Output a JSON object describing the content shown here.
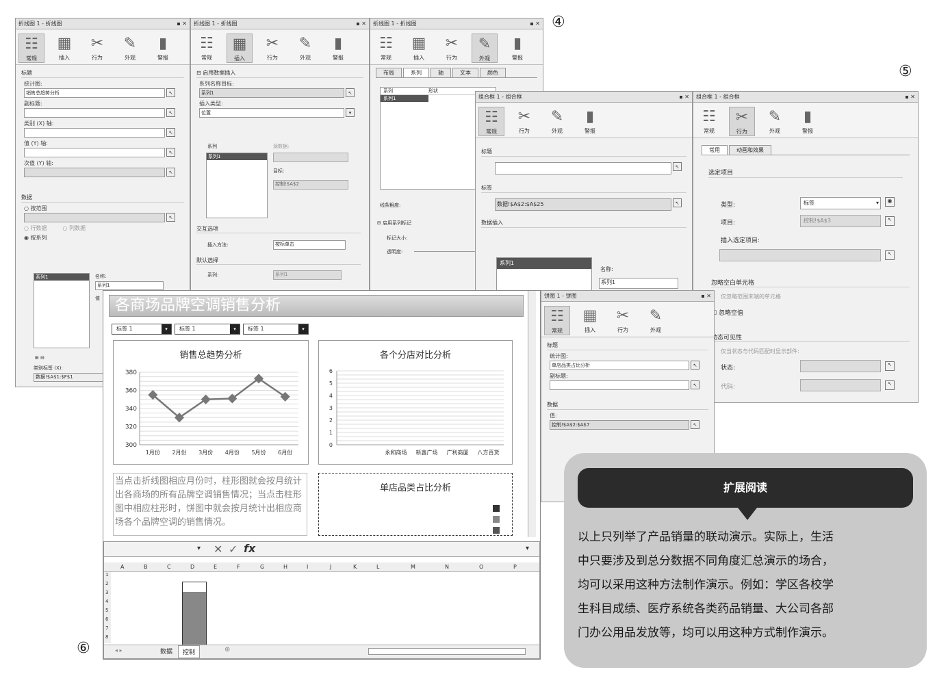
{
  "markers": {
    "four": "④",
    "five": "⑤",
    "six": "⑥"
  },
  "ribbon": {
    "general": "常规",
    "insert": "插入",
    "action": "行为",
    "appearance": "外观",
    "alert": "警报"
  },
  "panel1": {
    "title": "折线图 1 - 折线图",
    "section_title": "标题",
    "chart_label": "统计图:",
    "chart_value": "销售总趋势分析",
    "subtitle_label": "副标题:",
    "category_label": "类别 (X) 轴:",
    "value_label": "值 (Y) 轴:",
    "secondary_label": "次值 (Y) 轴:",
    "data_section": "数据",
    "by_range": "按范围",
    "row_label": "行数据",
    "col_label": "列数据",
    "by_series": "按系列",
    "series_item": "系列1",
    "name_label": "名称:",
    "name_value": "系列1",
    "value_short": "值",
    "category_axis_label": "类别标签 (X):",
    "category_axis_value": "数据!$A$1:$F$1"
  },
  "panel2": {
    "title": "折线图 1 - 折线图",
    "enable_insert": "启用数据插入",
    "series_target_label": "系列名称目标:",
    "series_target_value": "系列1",
    "insert_type_label": "插入类型:",
    "insert_type_value": "位置",
    "series_col": "系列",
    "source_col": "源数据:",
    "series_item": "系列1",
    "target_label": "目标:",
    "target_value": "控制!$A$2",
    "interaction_section": "交互选项",
    "insert_method_label": "插入方法:",
    "insert_method_value": "按标单击",
    "default_section": "默认选择",
    "series_label": "系列:",
    "series_default": "系列1"
  },
  "panel3": {
    "title": "折线图 1 - 折线图",
    "tabs": [
      "布局",
      "系列",
      "轴",
      "文本",
      "颜色"
    ],
    "col_series": "系列",
    "col_shape": "形状",
    "series_item": "系列1",
    "line_thickness": "线条粗度:",
    "enable_marker": "启用系列标记",
    "marker_size": "标记大小:",
    "transparency": "透明度:"
  },
  "panel4": {
    "title": "组合框 1 - 组合框",
    "section_title": "标题",
    "label_section": "标签",
    "label_value": "数据!$A$2:$A$25",
    "insert_section": "数据插入",
    "series_item": "系列1",
    "name_label": "名称:",
    "name_value": "系列1"
  },
  "panel5": {
    "title": "组合框 1 - 组合框",
    "tabs": [
      "常用",
      "动画和效果"
    ],
    "selected_item": "选定项目",
    "type_label": "类型:",
    "type_value": "标签",
    "item_label": "项目:",
    "item_value": "控制!$A$3",
    "insert_selected": "插入选定项目:",
    "ignore_blank_section": "忽略空白单元格",
    "ignore_blank_desc": "仅忽略范围末端的单元格",
    "ignore_blank_check": "忽略空值",
    "visibility_section": "动态可见性",
    "visibility_desc": "仅当状态与代码匹配时显示部件:",
    "status_label": "状态:",
    "code_label": "代码:"
  },
  "panel6": {
    "title": "饼图 1 - 饼图",
    "section_title": "标题",
    "chart_label": "统计图:",
    "chart_value": "单店品类占比分析",
    "subtitle_label": "副标题:",
    "data_section": "数据",
    "value_label": "值:",
    "value_value": "控制!$A$2:$A$7"
  },
  "dashboard": {
    "title": "各商场品牌空调销售分析",
    "dropdowns": [
      "标签 1",
      "标签 1",
      "标签 1"
    ],
    "description": "当点击折线图相应月份时，柱形图就会按月统计出各商场的所有品牌空调销售情况；当点击柱形图中相应柱形时，饼图中就会按月统计出相应商场各个品牌空调的销售情况。"
  },
  "line_chart": {
    "title": "销售总趋势分析",
    "categories": [
      "1月份",
      "2月份",
      "3月份",
      "4月份",
      "5月份",
      "6月份"
    ],
    "values": [
      355,
      330,
      350,
      351,
      373,
      353
    ],
    "yticks": [
      "380",
      "360",
      "340",
      "320",
      "300"
    ],
    "ylim": [
      300,
      380
    ],
    "color": "#777777"
  },
  "bar_chart": {
    "title": "各个分店对比分析",
    "categories": [
      "永和商场",
      "新鑫广场",
      "广利商厦",
      "八方百货"
    ],
    "yticks": [
      "6",
      "5",
      "4",
      "3",
      "2",
      "1",
      "0"
    ]
  },
  "pie_chart": {
    "title": "单店品类占比分析"
  },
  "chart_data": [
    {
      "type": "line",
      "title": "销售总趋势分析",
      "categories": [
        "1月份",
        "2月份",
        "3月份",
        "4月份",
        "5月份",
        "6月份"
      ],
      "series": [
        {
          "values": [
            355,
            330,
            350,
            351,
            373,
            353
          ]
        }
      ],
      "ylim": [
        300,
        380
      ],
      "grid": true
    },
    {
      "type": "bar",
      "title": "各个分店对比分析",
      "categories": [
        "永和商场",
        "新鑫广场",
        "广利商厦",
        "八方百货"
      ],
      "series": [
        {
          "values": [
            0,
            0,
            0,
            0
          ]
        }
      ],
      "ylim": [
        0,
        6
      ],
      "grid": true
    },
    {
      "type": "pie",
      "title": "单店品类占比分析",
      "values": []
    }
  ],
  "spreadsheet": {
    "fx": "fx",
    "columns": [
      "A",
      "B",
      "C",
      "D",
      "E",
      "F",
      "G",
      "H",
      "I",
      "J",
      "K",
      "L",
      "M",
      "N",
      "O",
      "P"
    ],
    "rows": [
      "1",
      "2",
      "3",
      "4",
      "5",
      "6",
      "7",
      "8"
    ],
    "sheet_tabs": [
      "数据",
      "控制"
    ]
  },
  "callout": {
    "heading": "扩展阅读",
    "lines": [
      "以上只列举了产品销量的联动演示。实际上，生活",
      "中只要涉及到总分数据不同角度汇总演示的场合，",
      "均可以采用这种方法制作演示。例如：学区各校学",
      "生科目成绩、医疗系统各类药品销量、大公司各部",
      "门办公用品发放等，均可以用这种方式制作演示。"
    ]
  }
}
